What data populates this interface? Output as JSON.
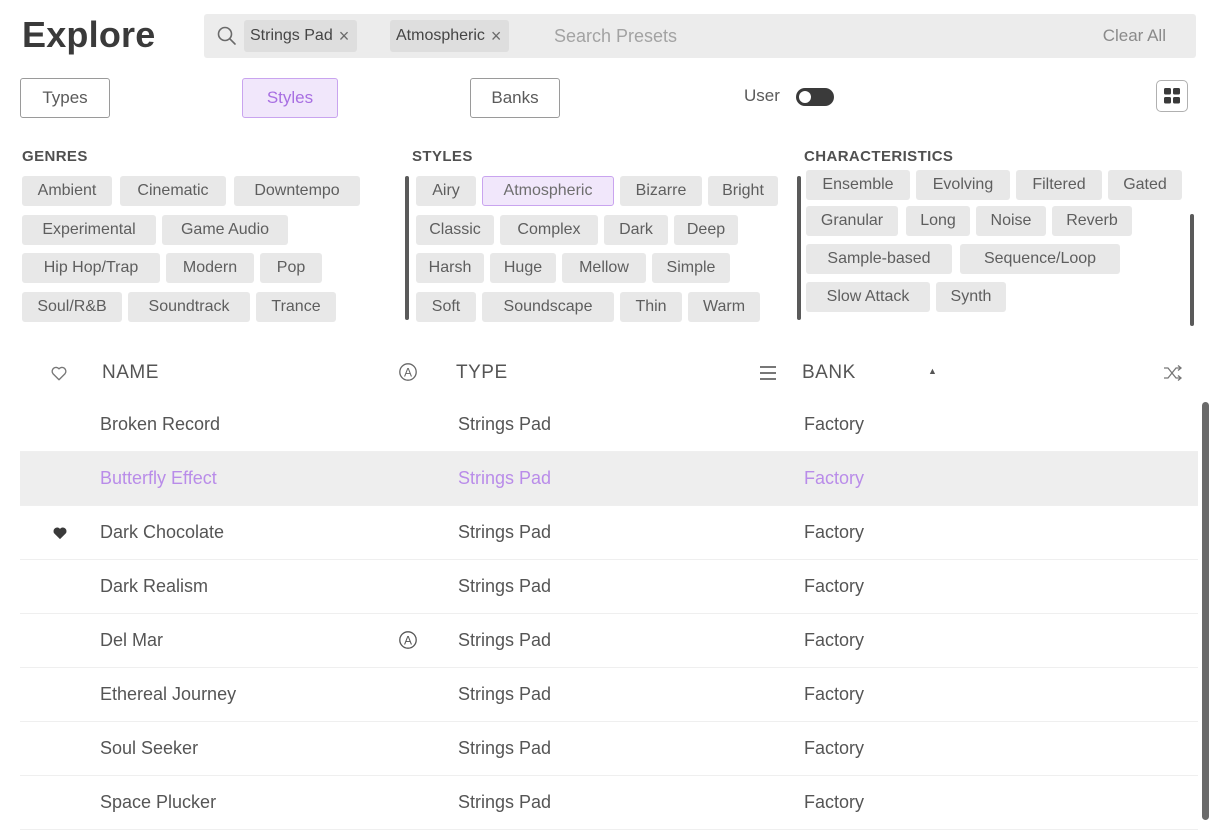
{
  "title": "Explore",
  "search": {
    "chips": [
      {
        "label": "Strings Pad",
        "close": "×"
      },
      {
        "label": "Atmospheric",
        "close": "×"
      }
    ],
    "placeholder": "Search Presets",
    "clear_label": "Clear All"
  },
  "filters": {
    "types_label": "Types",
    "styles_label": "Styles",
    "banks_label": "Banks",
    "user_label": "User",
    "user_toggle_on": false,
    "active": "Styles"
  },
  "sections": {
    "genres": {
      "title": "GENRES",
      "tags": [
        "Ambient",
        "Cinematic",
        "Downtempo",
        "Experimental",
        "Game Audio",
        "Hip Hop/Trap",
        "Modern",
        "Pop",
        "Soul/R&B",
        "Soundtrack",
        "Trance"
      ]
    },
    "styles": {
      "title": "STYLES",
      "tags": [
        "Airy",
        "Atmospheric",
        "Bizarre",
        "Bright",
        "Classic",
        "Complex",
        "Dark",
        "Deep",
        "Harsh",
        "Huge",
        "Mellow",
        "Simple",
        "Soft",
        "Soundscape",
        "Thin",
        "Warm"
      ],
      "selected": [
        "Atmospheric"
      ]
    },
    "characteristics": {
      "title": "CHARACTERISTICS",
      "tags": [
        "Ensemble",
        "Evolving",
        "Filtered",
        "Gated",
        "Granular",
        "Long",
        "Noise",
        "Reverb",
        "Sample-based",
        "Sequence/Loop",
        "Slow Attack",
        "Synth"
      ]
    }
  },
  "table": {
    "headers": {
      "name": "NAME",
      "type": "TYPE",
      "bank": "BANK",
      "sort_indicator": "▲"
    },
    "rows": [
      {
        "name": "Broken Record",
        "type": "Strings Pad",
        "bank": "Factory",
        "liked": false,
        "a_badge": false,
        "highlighted": false
      },
      {
        "name": "Butterfly Effect",
        "type": "Strings Pad",
        "bank": "Factory",
        "liked": false,
        "a_badge": false,
        "highlighted": true
      },
      {
        "name": "Dark Chocolate",
        "type": "Strings Pad",
        "bank": "Factory",
        "liked": true,
        "a_badge": false,
        "highlighted": false
      },
      {
        "name": "Dark Realism",
        "type": "Strings Pad",
        "bank": "Factory",
        "liked": false,
        "a_badge": false,
        "highlighted": false
      },
      {
        "name": "Del Mar",
        "type": "Strings Pad",
        "bank": "Factory",
        "liked": false,
        "a_badge": true,
        "highlighted": false
      },
      {
        "name": "Ethereal Journey",
        "type": "Strings Pad",
        "bank": "Factory",
        "liked": false,
        "a_badge": false,
        "highlighted": false
      },
      {
        "name": "Soul Seeker",
        "type": "Strings Pad",
        "bank": "Factory",
        "liked": false,
        "a_badge": false,
        "highlighted": false
      },
      {
        "name": "Space Plucker",
        "type": "Strings Pad",
        "bank": "Factory",
        "liked": false,
        "a_badge": false,
        "highlighted": false
      }
    ]
  },
  "colors": {
    "accent": "#a86fe2",
    "accent_bg": "#f1e7fb",
    "tag_bg": "#e8e8e8",
    "search_bg": "#ececec"
  }
}
